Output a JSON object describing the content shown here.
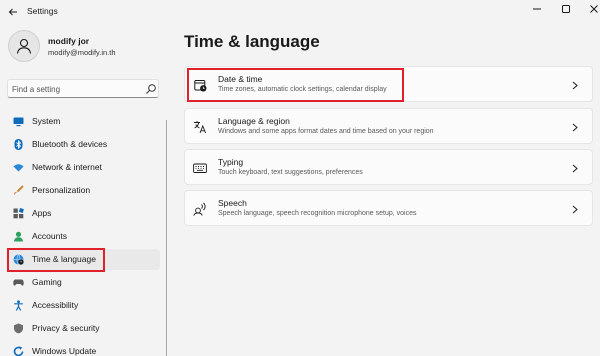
{
  "window": {
    "title": "Settings",
    "controls": [
      "minimize",
      "maximize",
      "close"
    ]
  },
  "user": {
    "name": "modify jor",
    "email": "modify@modify.in.th"
  },
  "search": {
    "placeholder": "Find a setting"
  },
  "sidebar": {
    "items": [
      {
        "label": "System",
        "icon": "monitor-icon"
      },
      {
        "label": "Bluetooth & devices",
        "icon": "bluetooth-icon"
      },
      {
        "label": "Network & internet",
        "icon": "wifi-icon"
      },
      {
        "label": "Personalization",
        "icon": "brush-icon"
      },
      {
        "label": "Apps",
        "icon": "apps-icon"
      },
      {
        "label": "Accounts",
        "icon": "account-icon"
      },
      {
        "label": "Time & language",
        "icon": "globe-clock-icon",
        "selected": true
      },
      {
        "label": "Gaming",
        "icon": "gamepad-icon"
      },
      {
        "label": "Accessibility",
        "icon": "accessibility-icon"
      },
      {
        "label": "Privacy & security",
        "icon": "shield-icon"
      },
      {
        "label": "Windows Update",
        "icon": "update-icon"
      }
    ]
  },
  "main": {
    "title": "Time & language",
    "cards": [
      {
        "title": "Date & time",
        "description": "Time zones, automatic clock settings, calendar display",
        "icon": "calendar-clock-icon",
        "highlighted": true
      },
      {
        "title": "Language & region",
        "description": "Windows and some apps format dates and time based on your region",
        "icon": "language-icon"
      },
      {
        "title": "Typing",
        "description": "Touch keyboard, text suggestions, preferences",
        "icon": "keyboard-icon"
      },
      {
        "title": "Speech",
        "description": "Speech language, speech recognition microphone setup, voices",
        "icon": "speech-icon"
      }
    ]
  },
  "colors": {
    "accent": "#005fb8",
    "highlight_box": "#e0202a",
    "background": "#f3f3f3",
    "card": "#fbfbfb"
  }
}
